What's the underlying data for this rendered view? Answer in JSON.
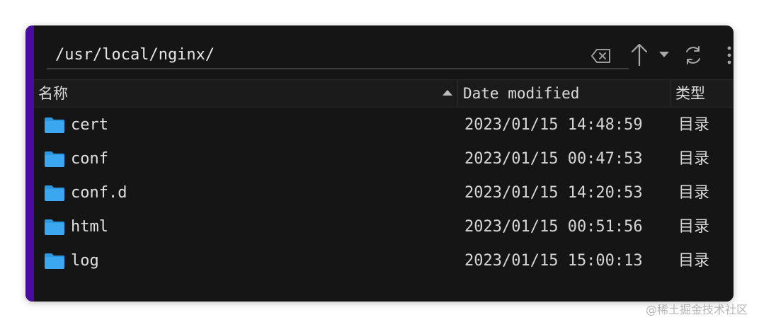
{
  "colors": {
    "accent": "#4a0ba0",
    "folder": "#3aa7f0"
  },
  "path_bar": {
    "path": "/usr/local/nginx/",
    "icons": [
      "backspace-icon",
      "arrow-up-icon",
      "caret-down-icon",
      "refresh-icon",
      "more-vertical-icon"
    ]
  },
  "columns": {
    "name": "名称",
    "date": "Date modified",
    "type": "类型"
  },
  "files": [
    {
      "name": "cert",
      "date": "2023/01/15 14:48:59",
      "type": "目录",
      "icon": "folder-icon"
    },
    {
      "name": "conf",
      "date": "2023/01/15 00:47:53",
      "type": "目录",
      "icon": "folder-icon"
    },
    {
      "name": "conf.d",
      "date": "2023/01/15 14:20:53",
      "type": "目录",
      "icon": "folder-icon"
    },
    {
      "name": "html",
      "date": "2023/01/15 00:51:56",
      "type": "目录",
      "icon": "folder-icon"
    },
    {
      "name": "log",
      "date": "2023/01/15 15:00:13",
      "type": "目录",
      "icon": "folder-icon"
    }
  ],
  "watermark": "@稀土掘金技术社区"
}
